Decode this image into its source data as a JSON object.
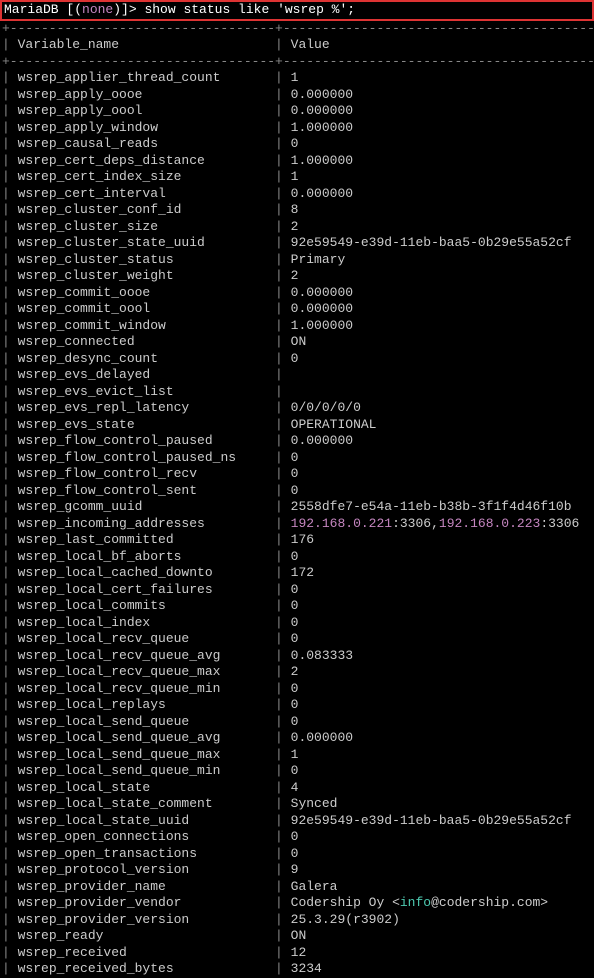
{
  "prompt": {
    "db_label": "MariaDB",
    "bracket_open": " [(",
    "schema": "none",
    "bracket_close": ")]>",
    "command": " show status like 'wsrep %';"
  },
  "divider": "+----------------------------------+-------------------------------------------",
  "header": {
    "col1": "Variable_name",
    "col2": "Value"
  },
  "ip1": "192.168.0.221",
  "ip2": "192.168.0.223",
  "port_a": ":3306,",
  "port_b": ":3306",
  "vendor_pre": "Codership Oy <",
  "vendor_mid": "info",
  "vendor_post": "@codership.com>",
  "rows": [
    {
      "n": "wsrep_applier_thread_count",
      "v": "1"
    },
    {
      "n": "wsrep_apply_oooe",
      "v": "0.000000"
    },
    {
      "n": "wsrep_apply_oool",
      "v": "0.000000"
    },
    {
      "n": "wsrep_apply_window",
      "v": "1.000000"
    },
    {
      "n": "wsrep_causal_reads",
      "v": "0"
    },
    {
      "n": "wsrep_cert_deps_distance",
      "v": "1.000000"
    },
    {
      "n": "wsrep_cert_index_size",
      "v": "1"
    },
    {
      "n": "wsrep_cert_interval",
      "v": "0.000000"
    },
    {
      "n": "wsrep_cluster_conf_id",
      "v": "8"
    },
    {
      "n": "wsrep_cluster_size",
      "v": "2"
    },
    {
      "n": "wsrep_cluster_state_uuid",
      "v": "92e59549-e39d-11eb-baa5-0b29e55a52cf"
    },
    {
      "n": "wsrep_cluster_status",
      "v": "Primary"
    },
    {
      "n": "wsrep_cluster_weight",
      "v": "2"
    },
    {
      "n": "wsrep_commit_oooe",
      "v": "0.000000"
    },
    {
      "n": "wsrep_commit_oool",
      "v": "0.000000"
    },
    {
      "n": "wsrep_commit_window",
      "v": "1.000000"
    },
    {
      "n": "wsrep_connected",
      "v": "ON"
    },
    {
      "n": "wsrep_desync_count",
      "v": "0"
    },
    {
      "n": "wsrep_evs_delayed",
      "v": ""
    },
    {
      "n": "wsrep_evs_evict_list",
      "v": ""
    },
    {
      "n": "wsrep_evs_repl_latency",
      "v": "0/0/0/0/0"
    },
    {
      "n": "wsrep_evs_state",
      "v": "OPERATIONAL"
    },
    {
      "n": "wsrep_flow_control_paused",
      "v": "0.000000"
    },
    {
      "n": "wsrep_flow_control_paused_ns",
      "v": "0"
    },
    {
      "n": "wsrep_flow_control_recv",
      "v": "0"
    },
    {
      "n": "wsrep_flow_control_sent",
      "v": "0"
    },
    {
      "n": "wsrep_gcomm_uuid",
      "v": "2558dfe7-e54a-11eb-b38b-3f1f4d46f10b"
    },
    {
      "n": "wsrep_incoming_addresses",
      "v": "__IPROW__"
    },
    {
      "n": "wsrep_last_committed",
      "v": "176"
    },
    {
      "n": "wsrep_local_bf_aborts",
      "v": "0"
    },
    {
      "n": "wsrep_local_cached_downto",
      "v": "172"
    },
    {
      "n": "wsrep_local_cert_failures",
      "v": "0"
    },
    {
      "n": "wsrep_local_commits",
      "v": "0"
    },
    {
      "n": "wsrep_local_index",
      "v": "0"
    },
    {
      "n": "wsrep_local_recv_queue",
      "v": "0"
    },
    {
      "n": "wsrep_local_recv_queue_avg",
      "v": "0.083333"
    },
    {
      "n": "wsrep_local_recv_queue_max",
      "v": "2"
    },
    {
      "n": "wsrep_local_recv_queue_min",
      "v": "0"
    },
    {
      "n": "wsrep_local_replays",
      "v": "0"
    },
    {
      "n": "wsrep_local_send_queue",
      "v": "0"
    },
    {
      "n": "wsrep_local_send_queue_avg",
      "v": "0.000000"
    },
    {
      "n": "wsrep_local_send_queue_max",
      "v": "1"
    },
    {
      "n": "wsrep_local_send_queue_min",
      "v": "0"
    },
    {
      "n": "wsrep_local_state",
      "v": "4"
    },
    {
      "n": "wsrep_local_state_comment",
      "v": "Synced"
    },
    {
      "n": "wsrep_local_state_uuid",
      "v": "92e59549-e39d-11eb-baa5-0b29e55a52cf"
    },
    {
      "n": "wsrep_open_connections",
      "v": "0"
    },
    {
      "n": "wsrep_open_transactions",
      "v": "0"
    },
    {
      "n": "wsrep_protocol_version",
      "v": "9"
    },
    {
      "n": "wsrep_provider_name",
      "v": "Galera"
    },
    {
      "n": "wsrep_provider_vendor",
      "v": "__VENDOR__"
    },
    {
      "n": "wsrep_provider_version",
      "v": "25.3.29(r3902)"
    },
    {
      "n": "wsrep_ready",
      "v": "ON"
    },
    {
      "n": "wsrep_received",
      "v": "12"
    },
    {
      "n": "wsrep_received_bytes",
      "v": "3234"
    }
  ]
}
